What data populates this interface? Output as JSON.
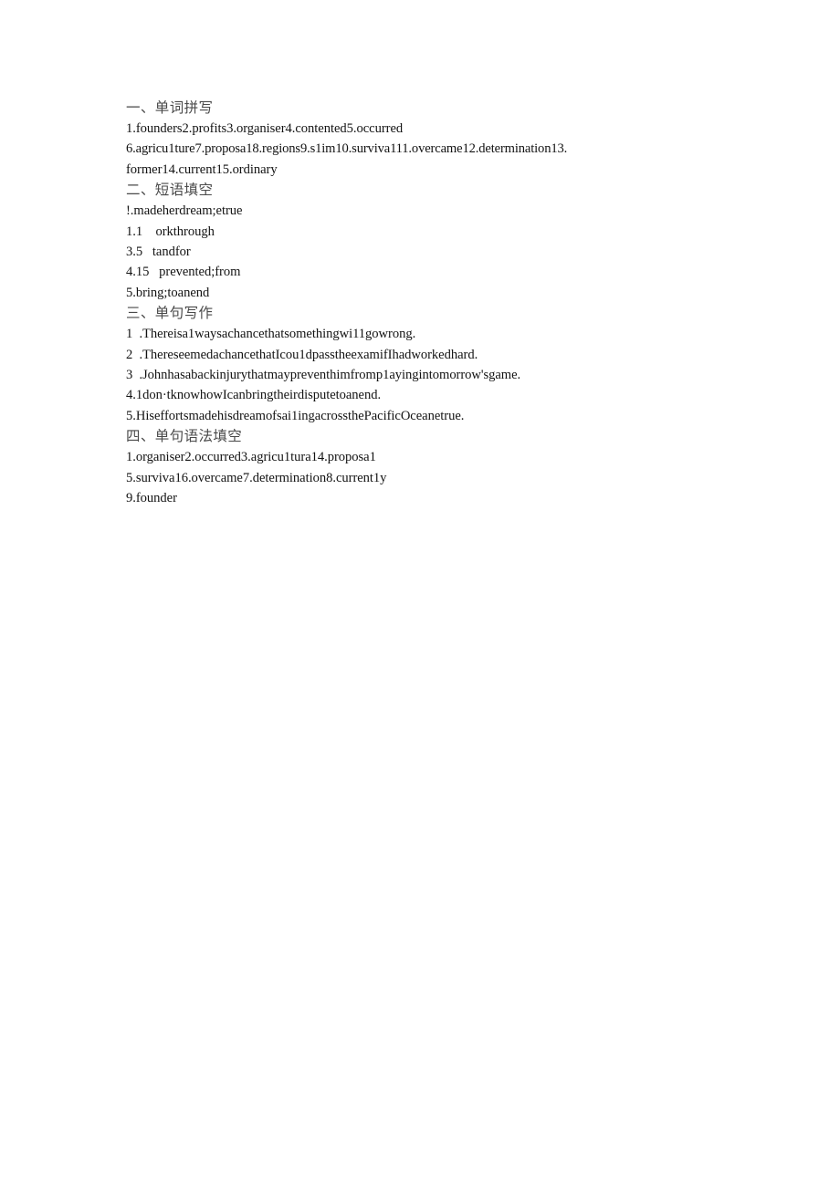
{
  "document": {
    "background_color": "#ffffff",
    "text_color": "#131313",
    "heading_color": "#4a4a4a",
    "sections": [
      {
        "heading": "一、单词拼写",
        "lines": [
          "1.founders2.profits3.organiser4.contented5.occurred",
          "6.agricu1ture7.proposa18.regions9.s1im10.surviva111.overcame12.determination13.",
          "former14.current15.ordinary"
        ]
      },
      {
        "heading": "二、短语填空",
        "lines": [
          "!.madeherdream;etrue",
          "1.1    orkthrough",
          "3.5   tandfor",
          "4.15   prevented;from",
          "5.bring;toanend"
        ]
      },
      {
        "heading": "三、单句写作",
        "lines": [
          "1  .Thereisa1waysachancethatsomethingwi11gowrong.",
          "2  .ThereseemedachancethatIcou1dpasstheexamifIhadworkedhard.",
          "3  .Johnhasabackinjurythatmaypreventhimfromp1ayingintomorrow'sgame.",
          "4.1don·tknowhowIcanbringtheirdisputetoanend.",
          "5.Hiseffortsmadehisdreamofsai1ingacrossthePacificOceanetrue."
        ]
      },
      {
        "heading": "四、单句语法填空",
        "lines": [
          "1.organiser2.occurred3.agricu1tura14.proposa1",
          "5.surviva16.overcame7.determination8.current1y",
          "9.founder"
        ]
      }
    ]
  }
}
